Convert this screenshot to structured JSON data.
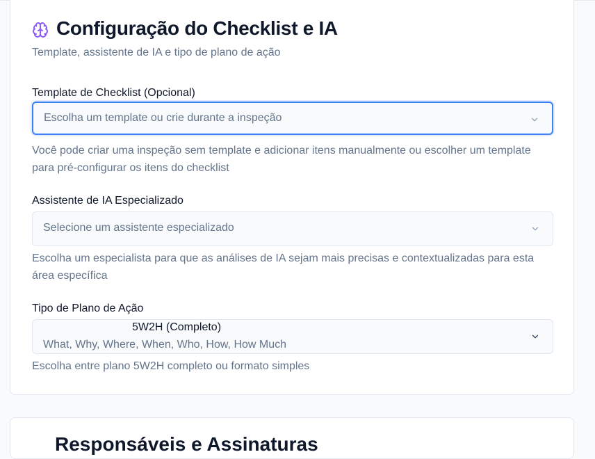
{
  "header": {
    "title": "Configuração do Checklist e IA",
    "subtitle": "Template, assistente de IA e tipo de plano de ação",
    "icon": "brain-icon",
    "icon_color": "#8b5cf6"
  },
  "template_field": {
    "label": "Template de Checklist (Opcional)",
    "placeholder": "Escolha um template ou crie durante a inspeção",
    "help": "Você pode criar uma inspeção sem template e adicionar itens manualmente ou escolher um template para pré-configurar os itens do checklist",
    "focus_color": "#3b82f6"
  },
  "assistant_field": {
    "label": "Assistente de IA Especializado",
    "placeholder": "Selecione um assistente especializado",
    "help": "Escolha um especialista para que as análises de IA sejam mais precisas e contextualizadas para esta área específica"
  },
  "plan_field": {
    "label": "Tipo de Plano de Ação",
    "selected_title": "5W2H (Completo)",
    "selected_description": "What, Why, Where, When, Who, How, How Much",
    "help": "Escolha entre plano 5W2H completo ou formato simples"
  },
  "next_section": {
    "title": "Responsáveis e Assinaturas"
  }
}
